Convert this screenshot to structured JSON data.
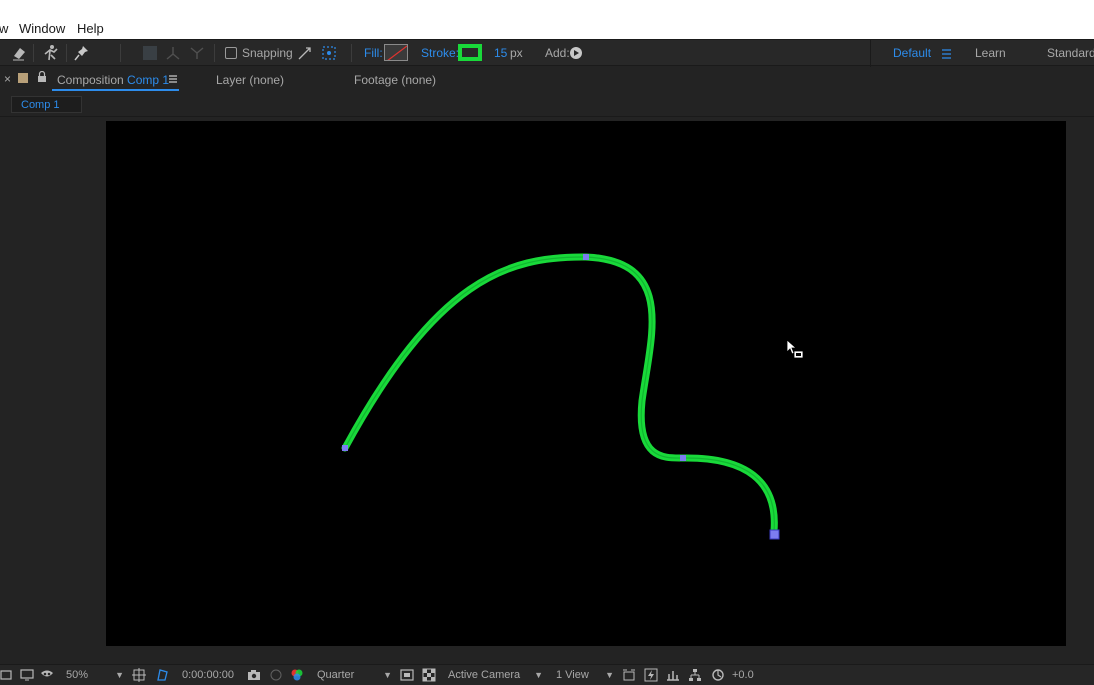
{
  "menubar": {
    "items": [
      {
        "label": "w"
      },
      {
        "label": "Window"
      },
      {
        "label": "Help"
      }
    ]
  },
  "toolbar": {
    "snapping_label": "Snapping",
    "fill_label": "Fill:",
    "stroke_label": "Stroke:",
    "stroke_width": "15",
    "stroke_unit": "px",
    "add_label": "Add:",
    "stroke_color": "#19d93a",
    "workspaces": [
      "Default",
      "Learn",
      "Standard"
    ]
  },
  "panels": {
    "composition_prefix": "Composition",
    "composition_name": "Comp 1",
    "layer_tab": "Layer (none)",
    "footage_tab": "Footage (none)"
  },
  "breadcrumb": {
    "comp": "Comp 1"
  },
  "viewer": {
    "background": "#000000",
    "path_color": "#19d93a",
    "vertex_color": "#7c7cf0"
  },
  "bottombar": {
    "zoom": "50%",
    "timecode": "0:00:00:00",
    "resolution": "Quarter",
    "camera": "Active Camera",
    "views": "1 View",
    "exposure": "+0.0"
  }
}
